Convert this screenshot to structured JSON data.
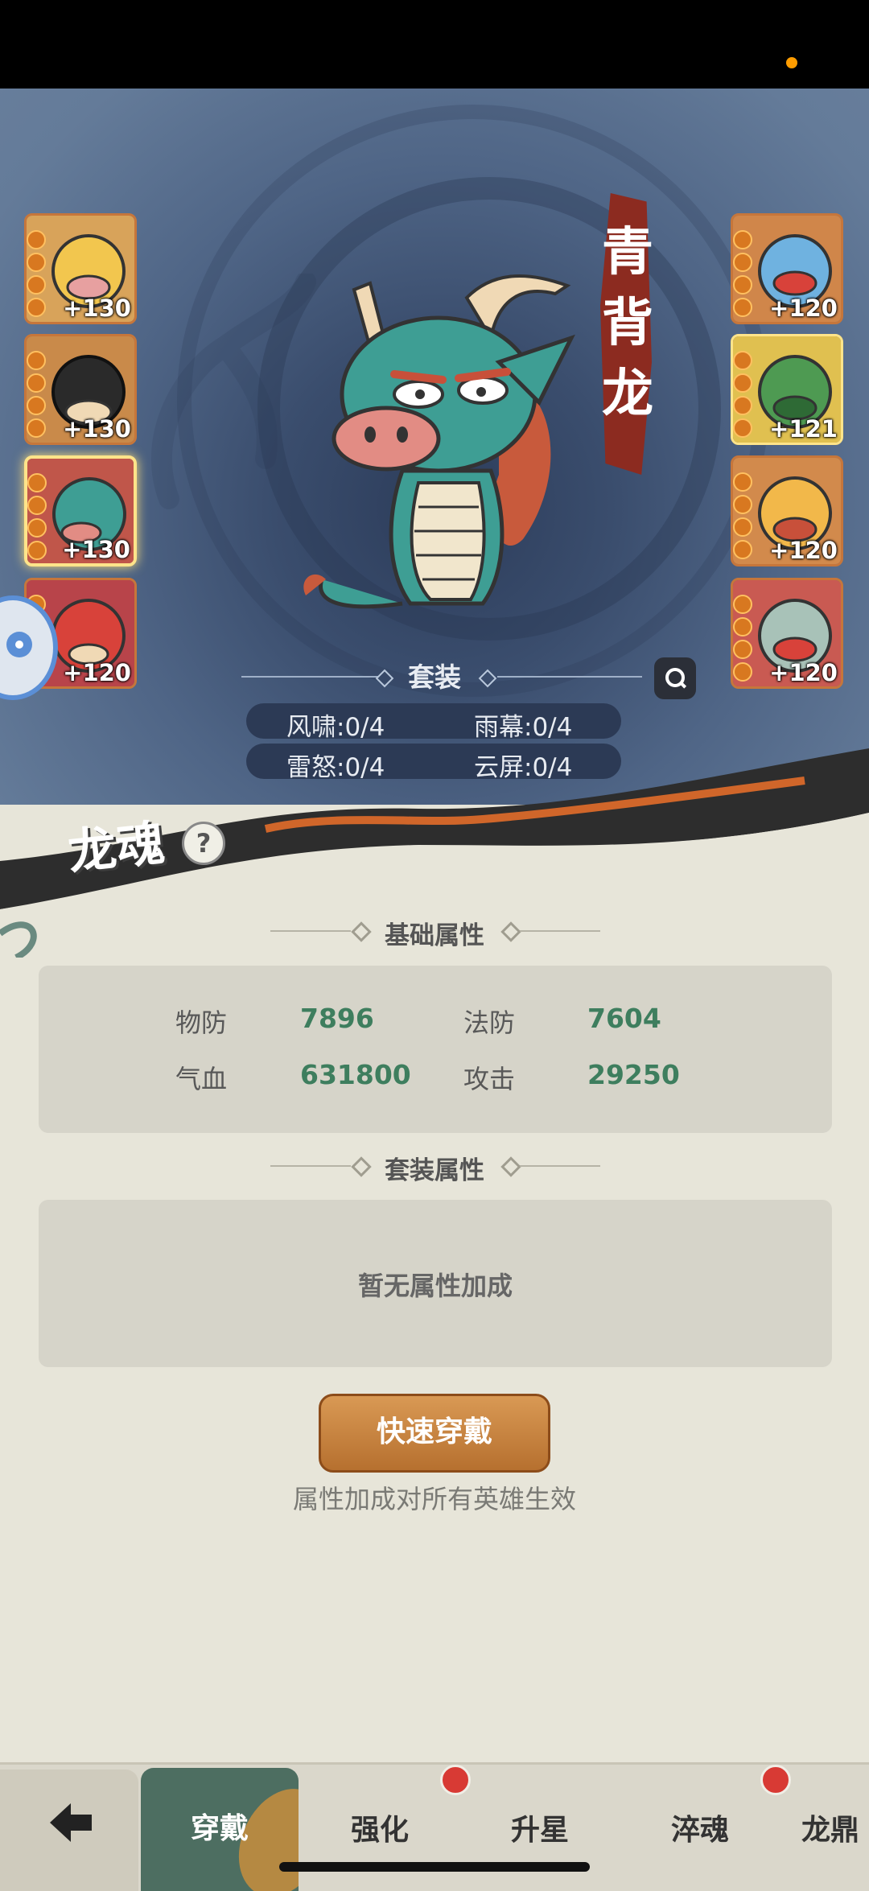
{
  "hero": {
    "name": "青背龙",
    "name_chars": [
      "青",
      "背",
      "龙"
    ]
  },
  "left_dragons": [
    {
      "level": "+130",
      "color": "#d8a35a"
    },
    {
      "level": "+130",
      "color": "#c98a4a"
    },
    {
      "level": "+130",
      "color": "#c0564a",
      "selected": true
    },
    {
      "level": "+120",
      "color": "#b8444a"
    }
  ],
  "right_dragons": [
    {
      "level": "+120",
      "color": "#d0864a"
    },
    {
      "level": "+121",
      "color": "#e0c050"
    },
    {
      "level": "+120",
      "color": "#d28a4c"
    },
    {
      "level": "+120",
      "color": "#c95a52"
    }
  ],
  "set": {
    "title": "套装",
    "items": [
      "风啸:0/4",
      "雨幕:0/4",
      "雷怒:0/4",
      "云屏:0/4"
    ]
  },
  "section_name": "龙魂",
  "help_glyph": "?",
  "base_attrs": {
    "title": "基础属性",
    "physical_def_label": "物防",
    "physical_def": "7896",
    "magic_def_label": "法防",
    "magic_def": "7604",
    "hp_label": "气血",
    "hp": "631800",
    "attack_label": "攻击",
    "attack": "29250"
  },
  "set_attrs": {
    "title": "套装属性",
    "empty_text": "暂无属性加成"
  },
  "quick_equip_label": "快速穿戴",
  "note": "属性加成对所有英雄生效",
  "tabs": {
    "equip": "穿戴",
    "enhance": "强化",
    "star": "升星",
    "temper": "淬魂",
    "more": "龙鼎"
  },
  "colors": {
    "accent_green": "#3e7e5e",
    "button": "#c88341",
    "badge_red": "#d83a34"
  }
}
